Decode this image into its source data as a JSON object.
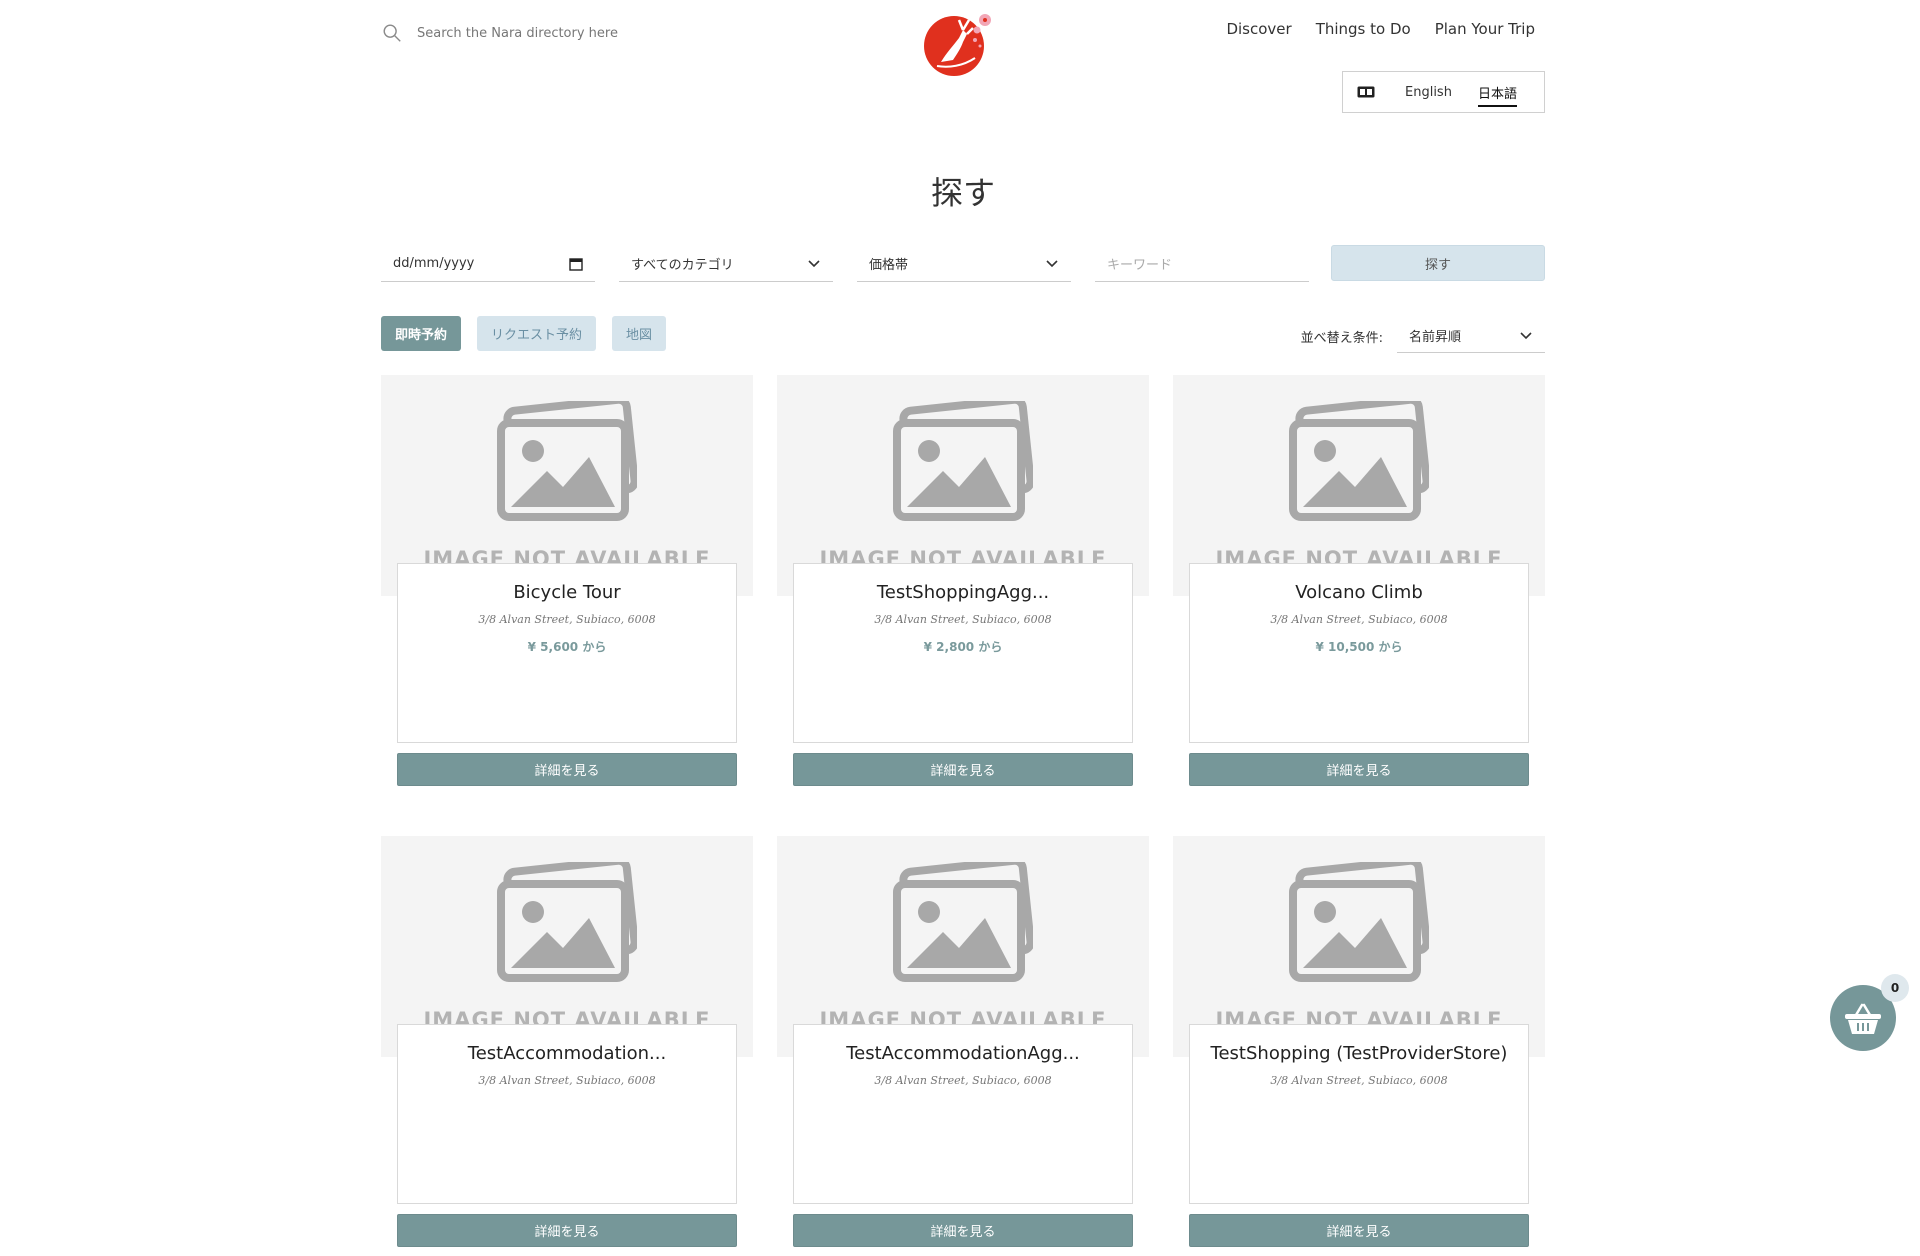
{
  "header": {
    "search_placeholder": "Search the Nara directory here",
    "nav": [
      "Discover",
      "Things to Do",
      "Plan Your Trip"
    ],
    "language": {
      "options": [
        "English",
        "日本語"
      ],
      "selected": "日本語"
    }
  },
  "page_title": "探す",
  "filters": {
    "date_placeholder": "dd/mm/yyyy",
    "category": "すべてのカテゴリ",
    "price": "価格帯",
    "keyword_placeholder": "キーワード",
    "search_label": "探す"
  },
  "chips": [
    {
      "label": "即時予約",
      "active": true
    },
    {
      "label": "リクエスト予約",
      "active": false
    },
    {
      "label": "地図",
      "active": false
    }
  ],
  "sort": {
    "label": "並べ替え条件:",
    "value": "名前昇順"
  },
  "listing": {
    "image_placeholder": "IMAGE NOT AVAILABLE",
    "button_label": "詳細を見る"
  },
  "cards": [
    {
      "name": "Bicycle Tour",
      "address": "3/8 Alvan Street, Subiaco, 6008",
      "price": "¥ 5,600 から"
    },
    {
      "name": "TestShoppingAgg...",
      "address": "3/8 Alvan Street, Subiaco, 6008",
      "price": "¥ 2,800 から"
    },
    {
      "name": "Volcano Climb",
      "address": "3/8 Alvan Street, Subiaco, 6008",
      "price": "¥ 10,500 から"
    },
    {
      "name": "TestAccommodation...",
      "address": "3/8 Alvan Street, Subiaco, 6008",
      "price": ""
    },
    {
      "name": "TestAccommodationAgg...",
      "address": "3/8 Alvan Street, Subiaco, 6008",
      "price": ""
    },
    {
      "name": "TestShopping (TestProviderStore)",
      "address": "3/8 Alvan Street, Subiaco, 6008",
      "price": ""
    }
  ],
  "cart": {
    "count": "0"
  },
  "colors": {
    "accent": "#769799",
    "logo_red": "#e0301e",
    "chip_light": "#d6e4ec"
  },
  "icons": [
    "search-icon",
    "nara-deer-logo",
    "language-icon",
    "calendar-icon",
    "chevron-down-icon",
    "image-placeholder-icon",
    "basket-icon"
  ]
}
